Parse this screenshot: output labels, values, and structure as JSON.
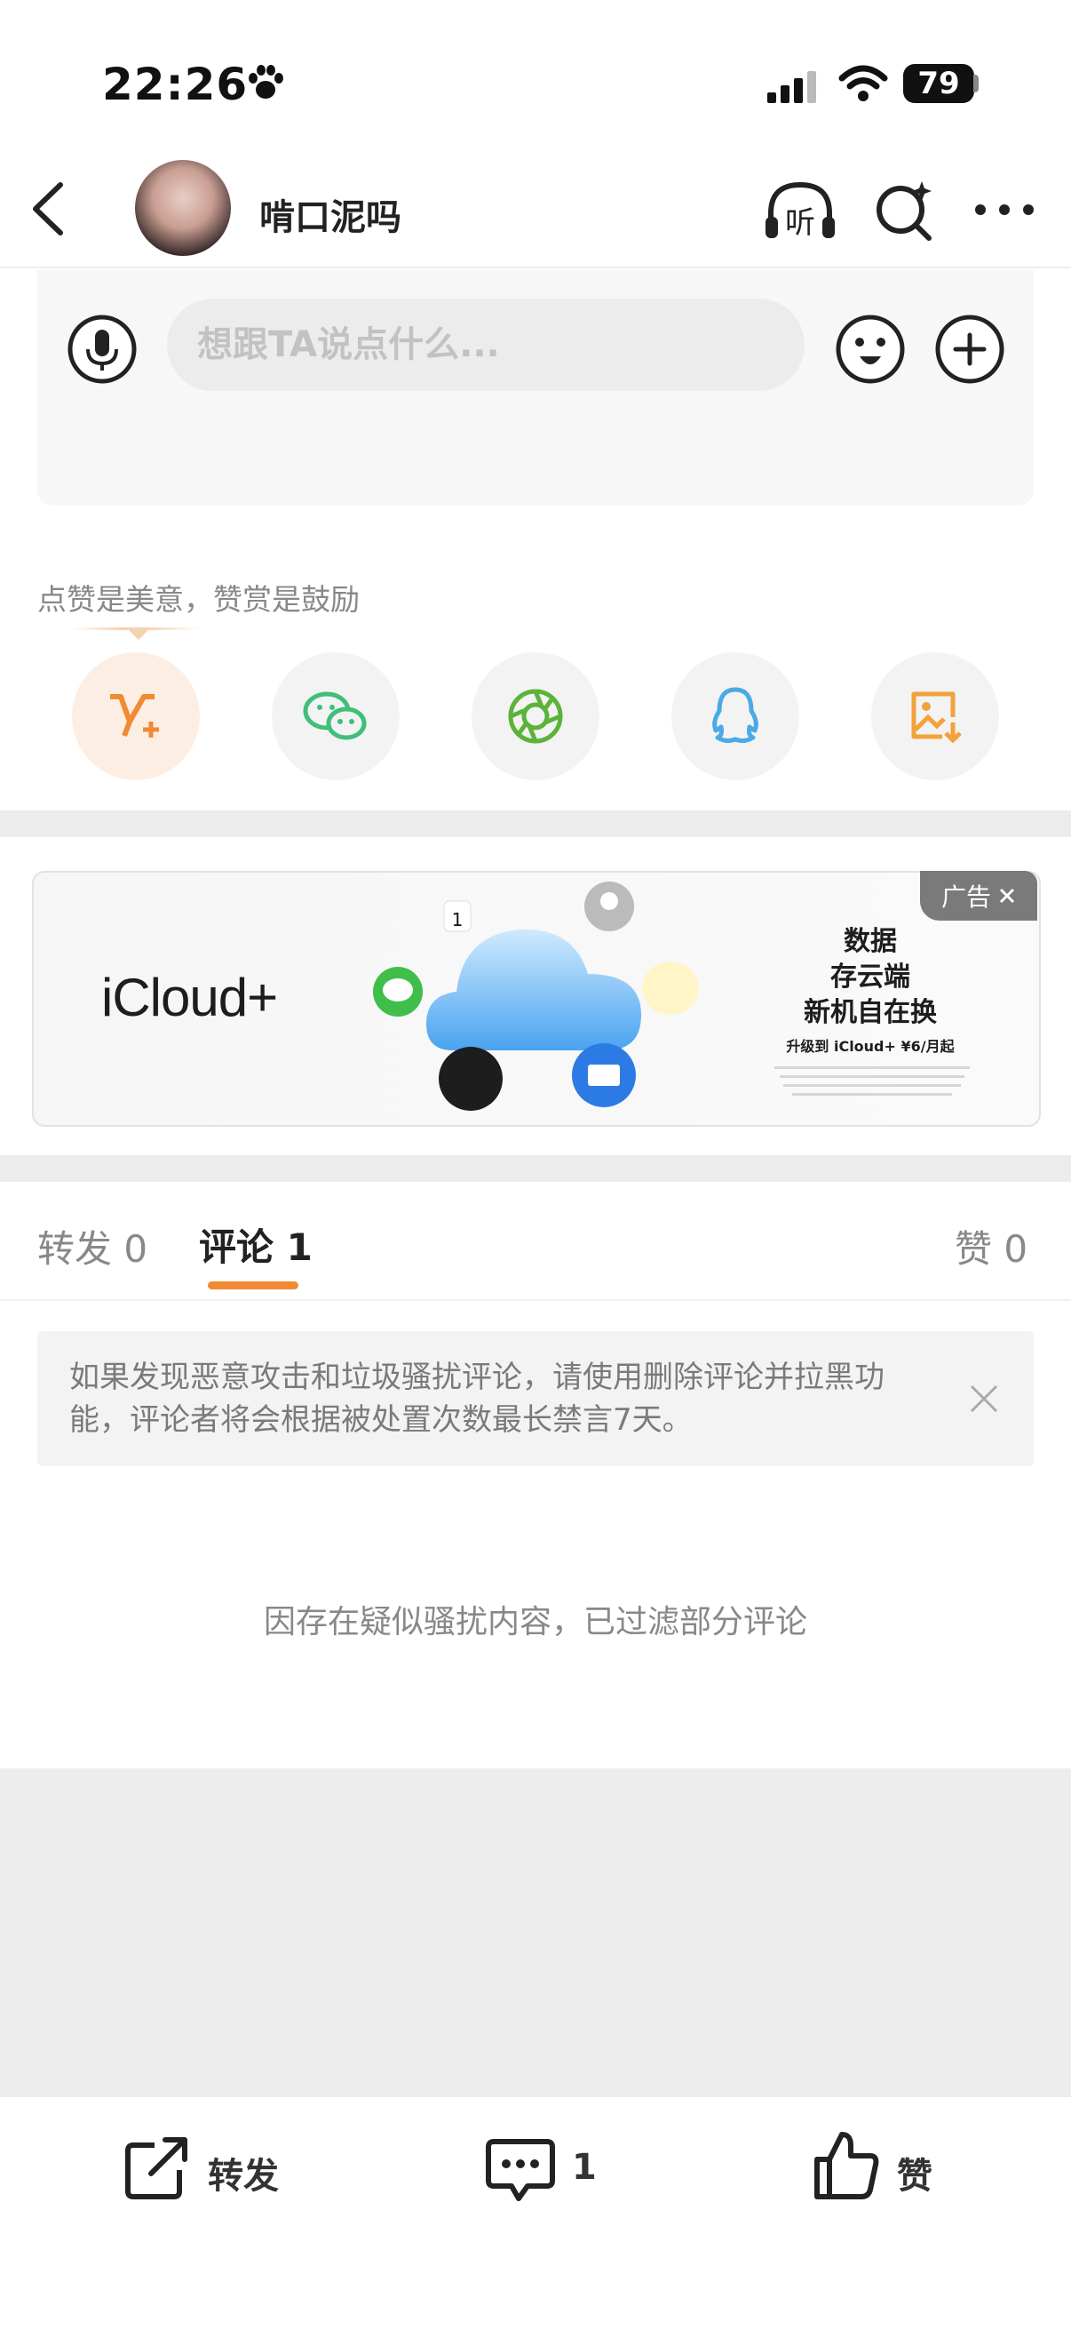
{
  "status_bar": {
    "time": "22:26",
    "battery": "79",
    "icons": [
      "paw-icon",
      "signal-icon",
      "wifi-icon",
      "battery-icon"
    ]
  },
  "nav": {
    "username": "啃口泥吗",
    "icons": [
      "back-icon",
      "listen-icon",
      "search-icon",
      "more-icon"
    ],
    "listen_glyph": "听"
  },
  "comment_box": {
    "placeholder": "想跟TA说点什么...",
    "icons": [
      "mic-icon",
      "emoji-icon",
      "plus-icon"
    ]
  },
  "share": {
    "tip": "点赞是美意，赞赏是鼓励",
    "targets": [
      "weibo-v-plus-icon",
      "wechat-icon",
      "moments-icon",
      "qq-icon",
      "save-image-icon"
    ]
  },
  "ad": {
    "badge": "广告",
    "brand": "iCloud+",
    "line1": "数据",
    "line2": "存云端",
    "line3": "新机自在换",
    "line4": "升级到 iCloud+ ¥6/月起"
  },
  "tabs": {
    "repost": "转发 0",
    "comment": "评论 1",
    "like": "赞 0"
  },
  "notice": {
    "text": "如果发现恶意攻击和垃圾骚扰评论，请使用删除评论并拉黑功能，评论者将会根据被处置次数最长禁言7天。"
  },
  "filtered_text": "因存在疑似骚扰内容，已过滤部分评论",
  "bottom_bar": {
    "repost": "转发",
    "comment": "1",
    "like": "赞"
  },
  "colors": {
    "accent": "#f08a33",
    "wechat": "#3fbf7a",
    "qq": "#4aa9e6",
    "save": "#f3a23a"
  }
}
